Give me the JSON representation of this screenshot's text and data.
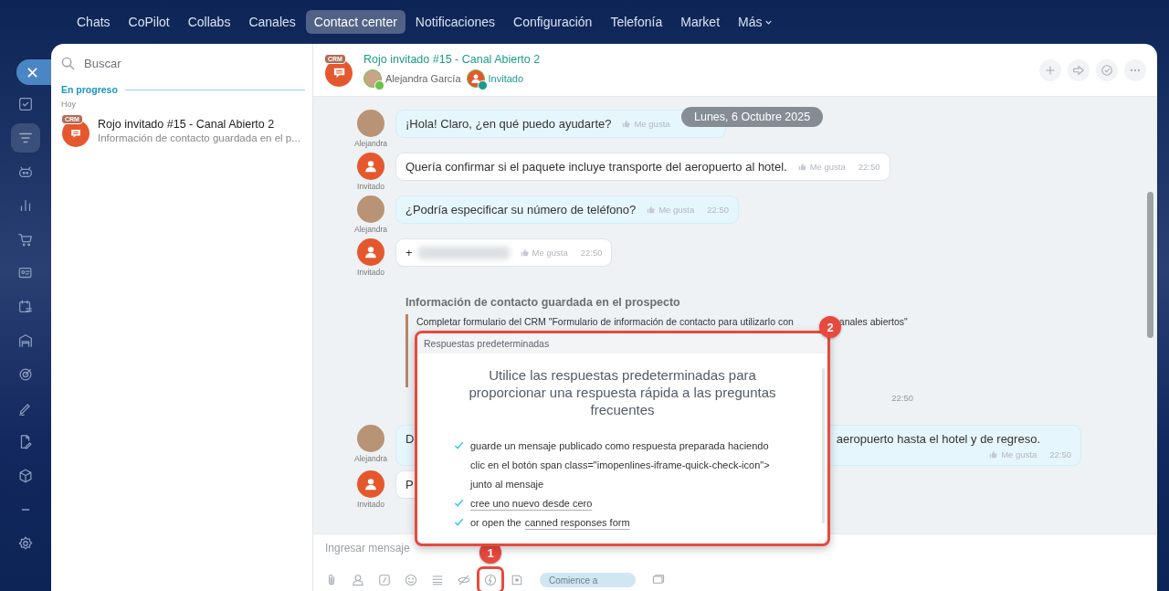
{
  "nav": {
    "tabs": [
      {
        "label": "Chats",
        "selected": false
      },
      {
        "label": "CoPilot",
        "selected": false
      },
      {
        "label": "Collabs",
        "selected": false
      },
      {
        "label": "Canales",
        "selected": false
      },
      {
        "label": "Contact center",
        "selected": true
      },
      {
        "label": "Notificaciones",
        "selected": false
      },
      {
        "label": "Configuración",
        "selected": false
      },
      {
        "label": "Telefonía",
        "selected": false
      },
      {
        "label": "Market",
        "selected": false
      },
      {
        "label": "Más",
        "selected": false,
        "dropdown": true
      }
    ]
  },
  "rail": {
    "items": [
      {
        "kind": "tasks",
        "selected": false
      },
      {
        "kind": "funnel",
        "selected": true
      },
      {
        "kind": "robot",
        "selected": false
      },
      {
        "kind": "chart",
        "selected": false
      },
      {
        "kind": "cart",
        "selected": false
      },
      {
        "kind": "contact",
        "selected": false
      },
      {
        "kind": "calendar",
        "selected": false
      },
      {
        "kind": "garage",
        "selected": false
      },
      {
        "kind": "target",
        "selected": false
      },
      {
        "kind": "pen",
        "selected": false
      },
      {
        "kind": "doc",
        "selected": false
      },
      {
        "kind": "box",
        "selected": false
      },
      {
        "kind": "dash",
        "selected": false
      },
      {
        "kind": "gear",
        "selected": false
      }
    ]
  },
  "sidebar": {
    "search": {
      "placeholder": "Buscar"
    },
    "section": "En progreso",
    "group": "Hoy",
    "chats": [
      {
        "badge": "CRM",
        "title": "Rojo invitado #15 - Canal Abierto 2",
        "preview": "Información de contacto guardada en el p..."
      }
    ]
  },
  "header": {
    "badge": "CRM",
    "title": "Rojo invitado #15 - Canal Abierto 2",
    "participants": [
      {
        "kind": "operator",
        "name": "Alejandra García"
      },
      {
        "kind": "guest",
        "name": "Invitado"
      }
    ]
  },
  "date_pill": "Lunes, 6 Octubre 2025",
  "messages": [
    {
      "kind": "operator",
      "author": "Alejandra",
      "fragments": [
        "¡Hola! Claro, ¿en qué puedo ayudarte?"
      ],
      "like": "Me gusta"
    },
    {
      "kind": "guest",
      "author": "Invitado",
      "fragments": [
        "Quería confirmar si el paquete incluye transporte del aeropuerto al hotel."
      ],
      "like": "Me gusta",
      "time": "22:50"
    },
    {
      "kind": "operator",
      "author": "Alejandra",
      "fragments": [
        "¿Podría especificar su número de teléfono?"
      ],
      "like": "Me gusta",
      "time": "22:50"
    },
    {
      "kind": "guest",
      "author": "Invitado",
      "fragments": [
        "+"
      ],
      "redacted": true,
      "like": "Me gusta",
      "time": "22:50"
    },
    {
      "kind": "system",
      "title": "Información de contacto guardada en el prospecto",
      "fragments": [
        "Completar formulario del CRM \"Formulario de información de contacto para utilizarlo con",
        "anales abiertos\""
      ],
      "time": "22:50"
    },
    {
      "kind": "operator",
      "author": "Alejandra",
      "fragments": [
        "D",
        "aeropuerto hasta el hotel y de regreso."
      ],
      "like": "Me gusta",
      "time": "22:50"
    },
    {
      "kind": "guest",
      "author": "Invitado",
      "fragments": [
        "P"
      ]
    }
  ],
  "popup": {
    "title": "Respuestas predeterminadas",
    "heading": "Utilice las respuestas predeterminadas para proporcionar una respuesta rápida a las preguntas frecuentes",
    "items": [
      {
        "text": "guarde un mensaje publicado como respuesta preparada haciendo clic en el botón span class=\"imopenlines-iframe-quick-check-icon\"> junto al mensaje"
      },
      {
        "link": "cree uno nuevo desde cero"
      },
      {
        "text": "or open the",
        "link": "canned responses form"
      }
    ]
  },
  "composer": {
    "placeholder": "Ingresar mensaje",
    "tools": [
      {
        "kind": "attach",
        "highlighted": false
      },
      {
        "kind": "person",
        "highlighted": false
      },
      {
        "kind": "slash",
        "highlighted": false
      },
      {
        "kind": "smile",
        "highlighted": false
      },
      {
        "kind": "lines",
        "highlighted": false
      },
      {
        "kind": "hidden",
        "highlighted": false
      },
      {
        "kind": "quick",
        "highlighted": true
      },
      {
        "kind": "note",
        "highlighted": false
      }
    ],
    "copilot": "Comience a"
  },
  "callouts": [
    "1",
    "2"
  ]
}
